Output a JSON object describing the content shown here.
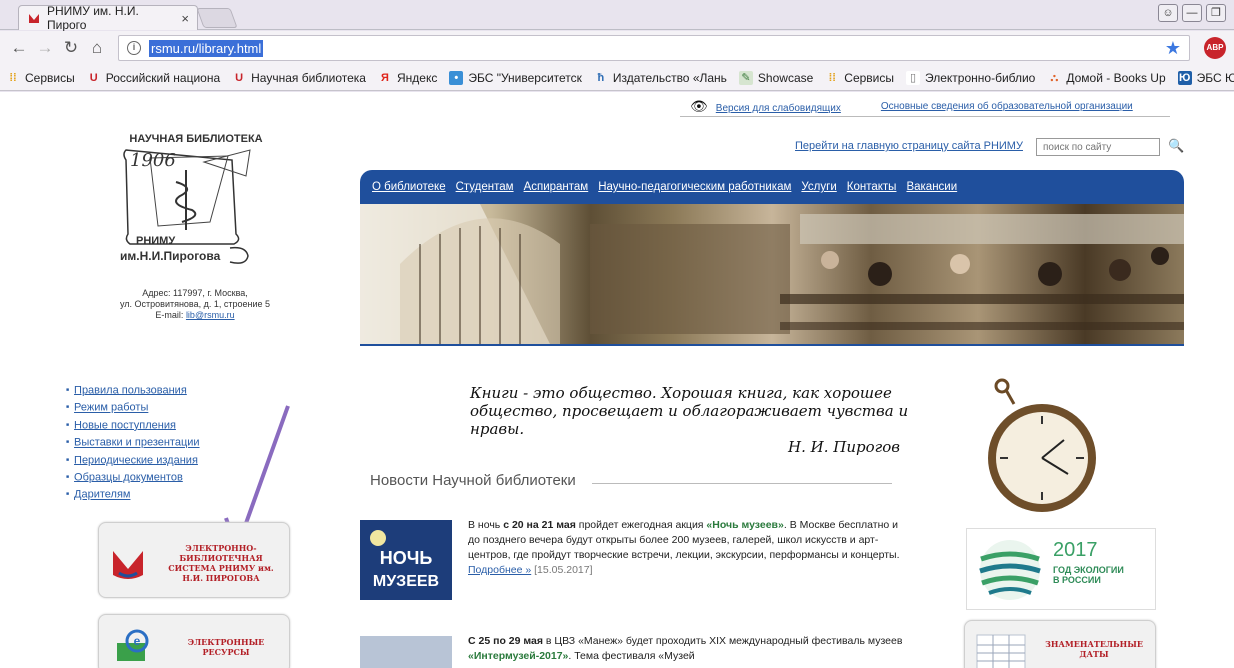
{
  "browser": {
    "tab_title": "РНИМУ им. Н.И. Пирого",
    "tab_close": "×",
    "url": "rsmu.ru/library.html",
    "abp_label": "ABP",
    "bookmarks": [
      {
        "label": "Сервисы",
        "icon": "apps-icon"
      },
      {
        "label": "Российский национа",
        "icon": "rsmu-icon"
      },
      {
        "label": "Научная библиотека",
        "icon": "rsmu-icon"
      },
      {
        "label": "Яндекс",
        "icon": "yandex-icon"
      },
      {
        "label": "ЭБС \"Университетск",
        "icon": "globe-icon"
      },
      {
        "label": "Издательство «Лань",
        "icon": "lan-icon"
      },
      {
        "label": "Showcase",
        "icon": "showcase-icon"
      },
      {
        "label": "Сервисы",
        "icon": "apps-icon"
      },
      {
        "label": "Электронно-библио",
        "icon": "page-icon"
      },
      {
        "label": "Домой - Books Up",
        "icon": "booksup-icon"
      },
      {
        "label": "ЭБС ЮРАЙТ",
        "icon": "urait-icon"
      }
    ]
  },
  "page": {
    "top_links": {
      "low_vision": "Версия для слабовидящих",
      "org_info": "Основные сведения об образовательной организации"
    },
    "logo": {
      "line1": "НАУЧНАЯ БИБЛИОТЕКА",
      "year": "1906",
      "line2": "РНИМУ",
      "line3": "им.Н.И.Пирогова"
    },
    "address": {
      "line1": "Адрес: 117997, г. Москва,",
      "line2": "ул. Островитянова, д. 1, строение 5",
      "email_label": "E-mail:",
      "email": "lib@rsmu.ru"
    },
    "main_site_link": "Перейти на главную страницу сайта РНИМУ",
    "search_placeholder": "поиск по сайту",
    "menu": [
      "О библиотеке",
      "Студентам",
      "Аспирантам",
      "Научно-педагогическим работникам",
      "Услуги",
      "Контакты",
      "Вакансии"
    ],
    "side_links": [
      "Правила пользования",
      "Режим работы",
      "Новые поступления",
      "Выставки и презентации",
      "Периодические издания",
      "Образцы документов",
      "Дарителям"
    ],
    "quote": {
      "text": "Книги - это общество. Хорошая книга, как хорошее общество, просвещает и облагораживает чувства и нравы.",
      "author": "Н. И. Пирогов"
    },
    "news_title": "Новости Научной библиотеки",
    "news": [
      {
        "img_label": "НОЧЬ МУЗЕЕВ",
        "p1": "В ночь ",
        "b1": "с 20 на 21 мая",
        "p2": " пройдет ежегодная акция ",
        "g1": "«Ночь музеев»",
        "p3": ". В Москве бесплатно и до позднего вечера будут открыты более 200 музеев, галерей, школ искусств и арт-центров, где пройдут творческие встречи, лекции, экскурсии, перформансы и концерты. ",
        "more": "Подробнее »",
        "date": "[15.05.2017]"
      },
      {
        "b1": "С 25 по 29 мая",
        "p1": " в ЦВЗ «Манеж» будет проходить XIX международный фестиваль музеев ",
        "g1": "«Интермузей-2017»",
        "p2": ". Тема фестиваля «Музей"
      }
    ],
    "tiles": {
      "ebs": "ЭЛЕКТРОННО-БИБЛИОТЕЧНАЯ СИСТЕМА РНИМУ им. Н.И. ПИРОГОВА",
      "eres": "ЭЛЕКТРОННЫЕ РЕСУРСЫ",
      "dates": "ЗНАМЕНАТЕЛЬНЫЕ ДАТЫ"
    },
    "eco": {
      "year": "2017",
      "line1": "ГОД ЭКОЛОГИИ",
      "line2": "В РОССИИ"
    }
  },
  "colors": {
    "menu_bg": "#1f4f9c",
    "link": "#2a5ea8",
    "accent_red": "#b32027",
    "annotation_arrow": "#8a6bbf"
  }
}
